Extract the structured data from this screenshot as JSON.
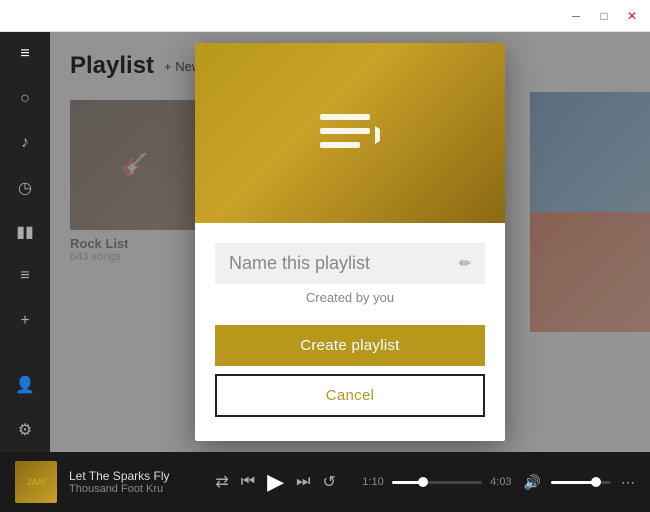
{
  "titleBar": {
    "minimizeLabel": "─",
    "maximizeLabel": "□",
    "closeLabel": "✕"
  },
  "sidebar": {
    "icons": [
      {
        "name": "menu-icon",
        "glyph": "≡",
        "active": true
      },
      {
        "name": "search-icon",
        "glyph": "🔍",
        "active": false
      },
      {
        "name": "music-icon",
        "glyph": "♪",
        "active": false
      },
      {
        "name": "recent-icon",
        "glyph": "🕐",
        "active": false
      },
      {
        "name": "chart-icon",
        "glyph": "📊",
        "active": false
      },
      {
        "name": "list-icon",
        "glyph": "≡",
        "active": false
      },
      {
        "name": "add-icon",
        "glyph": "+",
        "active": false
      },
      {
        "name": "person-icon",
        "glyph": "👤",
        "active": false
      },
      {
        "name": "settings-icon",
        "glyph": "⚙",
        "active": false
      }
    ]
  },
  "content": {
    "title": "Playlist",
    "newPlaylistBtn": "+ New playlist",
    "playlists": [
      {
        "name": "Rock List",
        "count": "643 songs",
        "color": "#5a3a2a"
      },
      {
        "name": "",
        "count": "",
        "color": "#3a6aaa"
      },
      {
        "name": "",
        "count": "",
        "color": "#2a6a4a"
      }
    ]
  },
  "dialog": {
    "playlistIcon": "☰",
    "nameText": "Name this playlist",
    "editIcon": "✏",
    "createdBy": "Created by you",
    "createBtn": "Create playlist",
    "cancelBtn": "Cancel"
  },
  "player": {
    "albumLabel": "JAM",
    "trackName": "Let The Sparks Fly",
    "artistName": "Thousand Foot Kru",
    "currentTime": "1:10",
    "totalTime": "4:03",
    "progressPercent": 28,
    "volumePercent": 75,
    "prevIcon": "⏮",
    "playIcon": "▶",
    "nextIcon": "⏭",
    "shuffleIcon": "⇄",
    "repeatIcon": "↺",
    "volumeIcon": "🔊",
    "moreIcon": "•••"
  }
}
